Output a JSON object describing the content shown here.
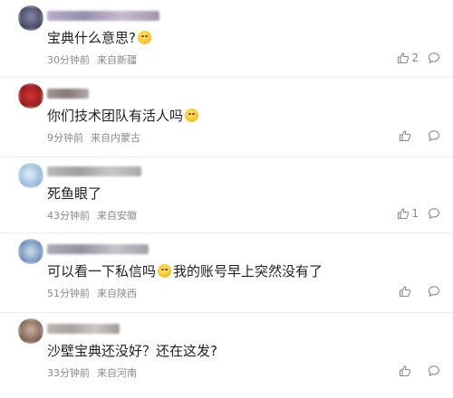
{
  "comments": [
    {
      "text": "宝典什么意思?",
      "emoji": "smile-emoji",
      "time": "30分钟前",
      "location": "来自新疆",
      "likes": "2",
      "avatar_color": "#4d4f6b",
      "name_color": "#9a8ea8"
    },
    {
      "text": "你们技术团队有活人吗",
      "emoji": "smirk-emoji",
      "time": "9分钟前",
      "location": "来自内蒙古",
      "likes": "",
      "avatar_color": "#a31d1d",
      "name_color": "#9a8f8f"
    },
    {
      "text": "死鱼眼了",
      "time": "43分钟前",
      "location": "来自安徽",
      "likes": "1",
      "avatar_color": "#7fb0d8",
      "name_color": "#a6a6a6"
    },
    {
      "text_before": "可以看一下私信吗",
      "text_after": "我的账号早上突然没有了",
      "emoji": "cry-emoji",
      "time": "51分钟前",
      "location": "来自陕西",
      "likes": "",
      "avatar_color": "#5b7fb0",
      "name_color": "#8e8e9c"
    },
    {
      "text": "沙壁宝典还没好？还在这发?",
      "time": "33分钟前",
      "location": "来自河南",
      "likes": "",
      "avatar_color": "#8a6e60",
      "name_color": "#a59e98"
    }
  ],
  "colors": {
    "meta": "#8a8a8a",
    "divider": "#eeeeee",
    "text": "#1f1f1f"
  }
}
